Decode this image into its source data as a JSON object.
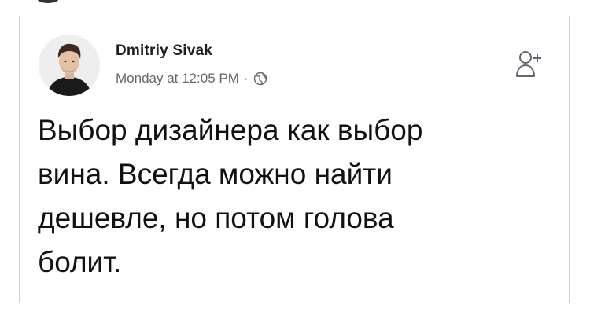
{
  "post": {
    "author_name": "Dmitriy Sivak",
    "timestamp": "Monday at 12:05 PM",
    "separator": "·",
    "privacy_icon": "globe-icon",
    "action_icon": "add-friend-icon",
    "text": "Выбор дизайнера как выбор\nвина. Всегда можно найти\nдешевле, но потом голова\nболит."
  },
  "colors": {
    "author": "#1c1e21",
    "meta": "#606770",
    "border": "#cfcfcf",
    "text": "#111111"
  }
}
